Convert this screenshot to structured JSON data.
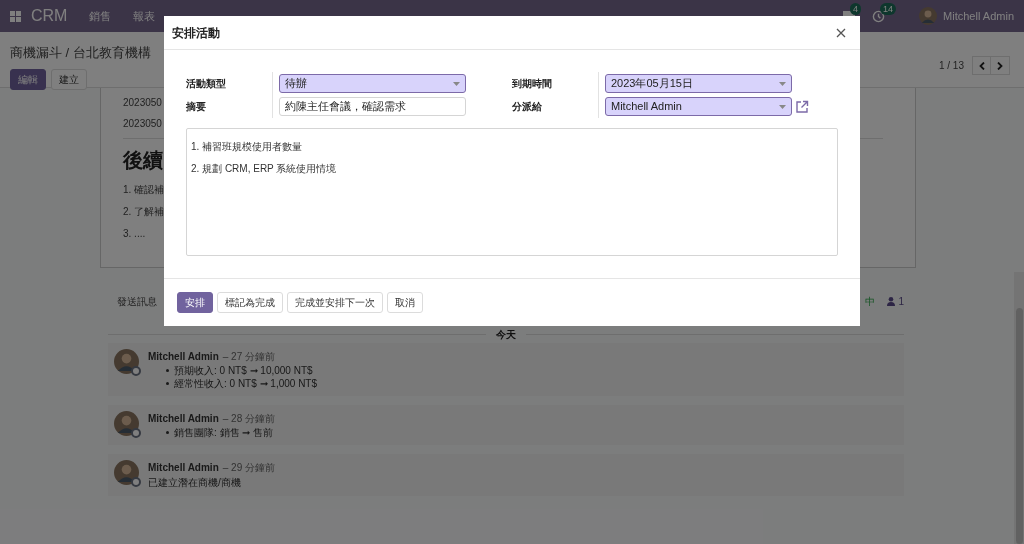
{
  "navbar": {
    "app_name": "CRM",
    "menu": [
      "銷售",
      "報表"
    ],
    "notifications": [
      {
        "kind": "chat",
        "count": "4"
      },
      {
        "kind": "activity",
        "count": "14"
      }
    ],
    "user": "Mitchell Admin"
  },
  "control_panel": {
    "breadcrumb": "商機漏斗 / 台北教育機構",
    "buttons": [
      {
        "label": "編輯",
        "primary": true
      },
      {
        "label": "建立",
        "primary": false
      }
    ],
    "pager": "1 / 13"
  },
  "sheet": {
    "lines": [
      "2023050",
      "2023050"
    ],
    "heading": "後續",
    "list": [
      "1. 確認補",
      "2. 了解補",
      "3. ...."
    ]
  },
  "chatter": {
    "send_message": "發送訊息",
    "follow_text": "中",
    "followers": "1",
    "date_divider": "今天",
    "messages": [
      {
        "kind": "tracking",
        "author": "Mitchell Admin",
        "time": "– 27 分鐘前",
        "changes": [
          "預期收入: 0 NT$ ➞ 10,000 NT$",
          "經常性收入: 0 NT$ ➞ 1,000 NT$"
        ]
      },
      {
        "kind": "tracking",
        "author": "Mitchell Admin",
        "time": "– 28 分鐘前",
        "changes": [
          "銷售團隊: 銷售 ➞ 售前"
        ]
      },
      {
        "kind": "note",
        "author": "Mitchell Admin",
        "time": "– 29 分鐘前",
        "body": "已建立潛在商機/商機"
      }
    ]
  },
  "dialog": {
    "title": "安排活動",
    "columns": [
      [
        {
          "label": "活動類型",
          "kind": "select",
          "value": "待辦"
        },
        {
          "label": "摘要",
          "kind": "text",
          "value": "約陳主任會議，確認需求"
        }
      ],
      [
        {
          "label": "到期時間",
          "kind": "select",
          "value": "2023年05月15日"
        },
        {
          "label": "分派給",
          "kind": "select",
          "value": "Mitchell Admin",
          "external_link": true
        }
      ]
    ],
    "note_lines": [
      "1. 補習班規模使用者數量",
      "2. 規劃 CRM, ERP 系統使用情境"
    ],
    "buttons": [
      {
        "label": "安排",
        "primary": true
      },
      {
        "label": "標記為完成",
        "primary": false
      },
      {
        "label": "完成並安排下一次",
        "primary": false
      },
      {
        "label": "取消",
        "primary": false
      }
    ]
  }
}
